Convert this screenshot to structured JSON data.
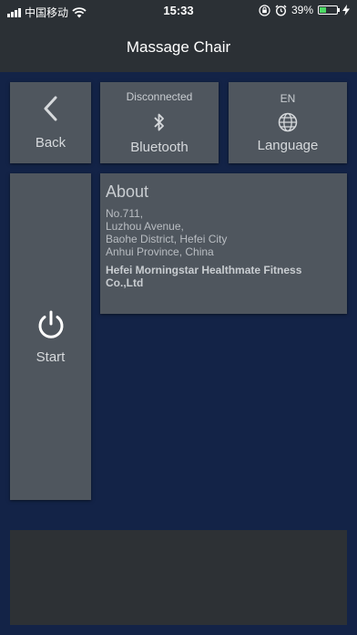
{
  "status_bar": {
    "carrier": "中国移动",
    "time": "15:33",
    "battery_percent": "39%",
    "battery_level": 0.39,
    "icons": [
      "signal-icon",
      "wifi-icon",
      "orientation-lock-icon",
      "alarm-icon",
      "battery-icon",
      "charging-icon"
    ]
  },
  "header": {
    "title": "Massage Chair"
  },
  "tiles": {
    "back": {
      "label": "Back",
      "icon": "chevron-left-icon"
    },
    "bluetooth": {
      "status": "Disconnected",
      "label": "Bluetooth",
      "icon": "bluetooth-icon"
    },
    "language": {
      "code": "EN",
      "label": "Language",
      "icon": "globe-icon"
    },
    "start": {
      "label": "Start",
      "icon": "power-icon"
    }
  },
  "about": {
    "title": "About",
    "address": [
      "No.711,",
      "Luzhou Avenue,",
      "Baohe District, Hefei City",
      "Anhui Province, China"
    ],
    "company": "Hefei Morningstar Healthmate Fitness Co.,Ltd"
  },
  "colors": {
    "background": "#132347",
    "bar": "#2b3035",
    "tile": "#4f565e",
    "battery_fill": "#4cd964"
  }
}
